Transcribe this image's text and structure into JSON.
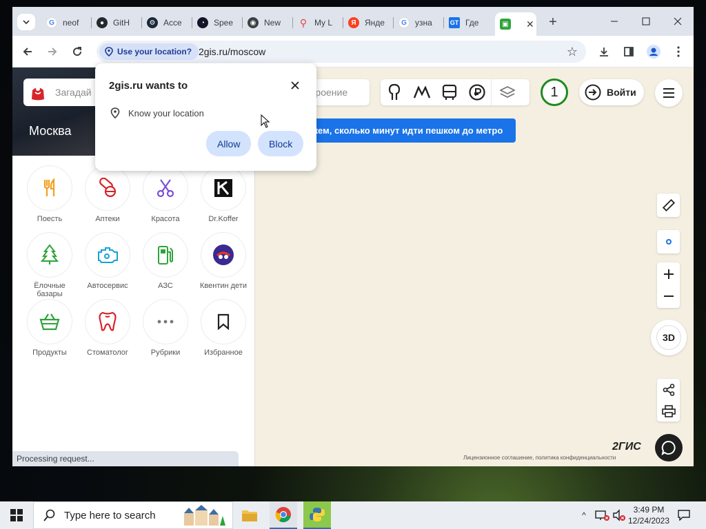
{
  "browser": {
    "tabs": [
      {
        "label": "neof",
        "favicon": "google-icon",
        "color": "#4285f4"
      },
      {
        "label": "GitH",
        "favicon": "github-icon",
        "color": "#24292e"
      },
      {
        "label": "Acce",
        "favicon": "steam-icon",
        "color": "#1b2838"
      },
      {
        "label": "Spee",
        "favicon": "speedtest-icon",
        "color": "#141526"
      },
      {
        "label": "New",
        "favicon": "chrome-icon",
        "color": "#3c4043"
      },
      {
        "label": "My L",
        "favicon": "maps-pin-icon",
        "color": "#ea4335"
      },
      {
        "label": "Янде",
        "favicon": "yandex-icon",
        "color": "#fc3f1d"
      },
      {
        "label": "узна",
        "favicon": "google-icon",
        "color": "#4285f4"
      },
      {
        "label": "Где",
        "favicon": "gt-icon",
        "color": "#1a73e8"
      },
      {
        "label": "",
        "favicon": "2gis-icon",
        "color": "#2fa33b",
        "active": true
      }
    ],
    "address": {
      "chip_label": "Use your location?",
      "url": "2gis.ru/moscow"
    },
    "status_text": "Processing request..."
  },
  "permission_popup": {
    "title": "2gis.ru wants to",
    "item": "Know your location",
    "allow_label": "Allow",
    "block_label": "Block"
  },
  "site": {
    "search_placeholder": "Загадай",
    "city": "Москва",
    "route_placeholder": "строение",
    "promo_text": "жем, сколько минут идти пешком до метро",
    "traffic_score": "1",
    "login_label": "Войти",
    "rubrics": [
      {
        "label": "Поесть",
        "icon": "fork-knife-icon"
      },
      {
        "label": "Аптеки",
        "icon": "pills-icon"
      },
      {
        "label": "Красота",
        "icon": "scissors-icon"
      },
      {
        "label": "Dr.Koffer",
        "icon": "drkoffer-logo-icon"
      },
      {
        "label": "Ёлочные базары",
        "icon": "fir-tree-icon"
      },
      {
        "label": "Автосервис",
        "icon": "engine-icon"
      },
      {
        "label": "АЗС",
        "icon": "fuel-pump-icon"
      },
      {
        "label": "Квентин дети",
        "icon": "kventin-logo-icon"
      },
      {
        "label": "Продукты",
        "icon": "basket-icon"
      },
      {
        "label": "Стоматолог",
        "icon": "tooth-icon"
      },
      {
        "label": "Рубрики",
        "icon": "more-dots-icon"
      },
      {
        "label": "Избранное",
        "icon": "bookmark-icon"
      }
    ],
    "compass_label": "3D",
    "brand": "2ГИС",
    "license_text": "Лицензионное соглашение, политика конфиденциальности"
  },
  "taskbar": {
    "search_placeholder": "Type here to search",
    "time": "3:49 PM",
    "date": "12/24/2023"
  },
  "colors": {
    "rubric_orange": "#f0a020",
    "rubric_red": "#d8232a",
    "rubric_purple": "#7b4fd6",
    "rubric_green": "#2fa33b",
    "rubric_blue": "#1aa0d6",
    "promo_blue": "#1a73e8",
    "traffic_green": "#1f8a1f"
  }
}
